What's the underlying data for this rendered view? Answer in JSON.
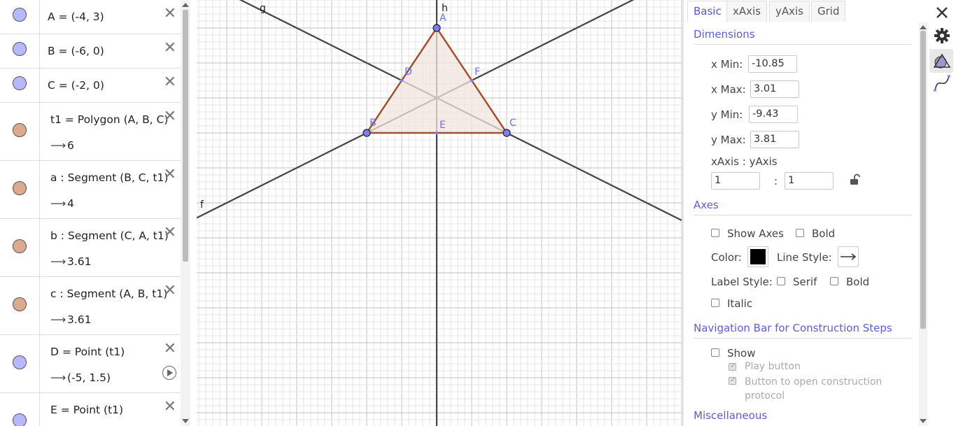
{
  "algebra": {
    "items": [
      {
        "def": "A = (-4, 3)",
        "marble": "blue"
      },
      {
        "def": "B = (-6, 0)",
        "marble": "blue"
      },
      {
        "def": "C = (-2, 0)",
        "marble": "blue"
      },
      {
        "def": "t1 = Polygon (A, B, C)",
        "out": "6",
        "marble": "brown"
      },
      {
        "def": "a : Segment (B, C, t1)",
        "out": "4",
        "marble": "brown"
      },
      {
        "def": "b : Segment (C, A, t1)",
        "out": "3.61",
        "marble": "brown"
      },
      {
        "def": "c : Segment (A, B, t1)",
        "out": "3.61",
        "marble": "brown"
      },
      {
        "def": "D = Point (t1)",
        "out": "(-5, 1.5)",
        "marble": "blue"
      },
      {
        "def": "E = Point (t1)",
        "marble": "blue"
      }
    ],
    "output_arrow": "⟶",
    "close_icon": "✕"
  },
  "graphics": {
    "view": {
      "xmin": -10.85,
      "xmax": 3.01,
      "ymin": -9.43,
      "ymax": 3.81
    },
    "points": [
      {
        "name": "A",
        "x": -4,
        "y": 3,
        "type": "free"
      },
      {
        "name": "B",
        "x": -6,
        "y": 0,
        "type": "free"
      },
      {
        "name": "C",
        "x": -2,
        "y": 0,
        "type": "free"
      },
      {
        "name": "D",
        "x": -5,
        "y": 1.5,
        "type": "onpath"
      },
      {
        "name": "E",
        "x": -4,
        "y": 0,
        "type": "onpath"
      },
      {
        "name": "F",
        "x": -3,
        "y": 1.5,
        "type": "onpath"
      }
    ],
    "lines": [
      {
        "name": "f",
        "through": [
          [
            -6,
            0
          ],
          [
            -3,
            1.5
          ]
        ]
      },
      {
        "name": "g",
        "through": [
          [
            -2,
            0
          ],
          [
            -5,
            1.5
          ]
        ]
      },
      {
        "name": "h",
        "through": [
          [
            -4,
            0
          ],
          [
            -4,
            3
          ]
        ]
      }
    ],
    "colors": {
      "polygon_stroke": "#a0522d",
      "polygon_fill": "#f3e6df",
      "point_fill": "#7c7cff",
      "line": "#444444",
      "grid_major": "#c0c0c0",
      "grid_minor": "#e6e6e6"
    }
  },
  "settings": {
    "tabs": [
      "Basic",
      "xAxis",
      "yAxis",
      "Grid"
    ],
    "active_tab": "Basic",
    "dimensions": {
      "title": "Dimensions",
      "xmin_label": "x Min:",
      "xmin": "-10.85",
      "xmax_label": "x Max:",
      "xmax": "3.01",
      "ymin_label": "y Min:",
      "ymin": "-9.43",
      "ymax_label": "y Max:",
      "ymax": "3.81",
      "ratio_label": "xAxis : yAxis",
      "ratio_x": "1",
      "ratio_sep": ":",
      "ratio_y": "1"
    },
    "axes": {
      "title": "Axes",
      "show_axes": "Show Axes",
      "show_axes_checked": false,
      "bold": "Bold",
      "bold_checked": false,
      "color_label": "Color:",
      "color": "#000000",
      "line_style_label": "Line Style:",
      "label_style_label": "Label Style:",
      "serif": "Serif",
      "label_bold": "Bold",
      "italic": "Italic"
    },
    "navigation": {
      "title": "Navigation Bar for Construction Steps",
      "show": "Show",
      "play_button": "Play button",
      "open_protocol": "Button to open construction protocol"
    },
    "misc_title": "Miscellaneous",
    "accent": "#5b5bd6"
  }
}
